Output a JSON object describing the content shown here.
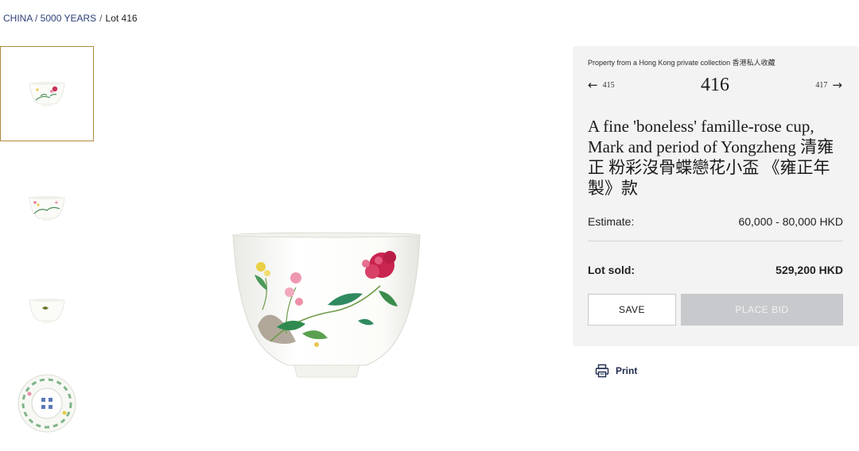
{
  "breadcrumb": {
    "link": "CHINA / 5000 YEARS",
    "separator": "/",
    "current": "Lot 416"
  },
  "thumbnails": [
    {
      "name": "cup-side-view-1",
      "selected": true
    },
    {
      "name": "cup-side-view-2",
      "selected": false
    },
    {
      "name": "cup-side-view-3",
      "selected": false
    },
    {
      "name": "cup-base-view",
      "selected": false
    }
  ],
  "lot": {
    "provenance": "Property from a Hong Kong private collection 香港私人收藏",
    "prev_number": "415",
    "number": "416",
    "next_number": "417",
    "title": "A fine 'boneless' famille-rose cup, Mark and period of Yongzheng 清雍正 粉彩沒骨蝶戀花小盃 《雍正年製》款",
    "estimate_label": "Estimate:",
    "estimate_value": "60,000 - 80,000 HKD",
    "sold_label": "Lot sold:",
    "sold_value": "529,200 HKD"
  },
  "actions": {
    "save_label": "SAVE",
    "bid_label": "PLACE BID",
    "print_label": "Print"
  },
  "colors": {
    "accent_link": "#2d3f7a",
    "selected_border": "#b08a3e",
    "panel_bg": "#f3f3f3",
    "disabled_button": "#c7c9cc"
  }
}
